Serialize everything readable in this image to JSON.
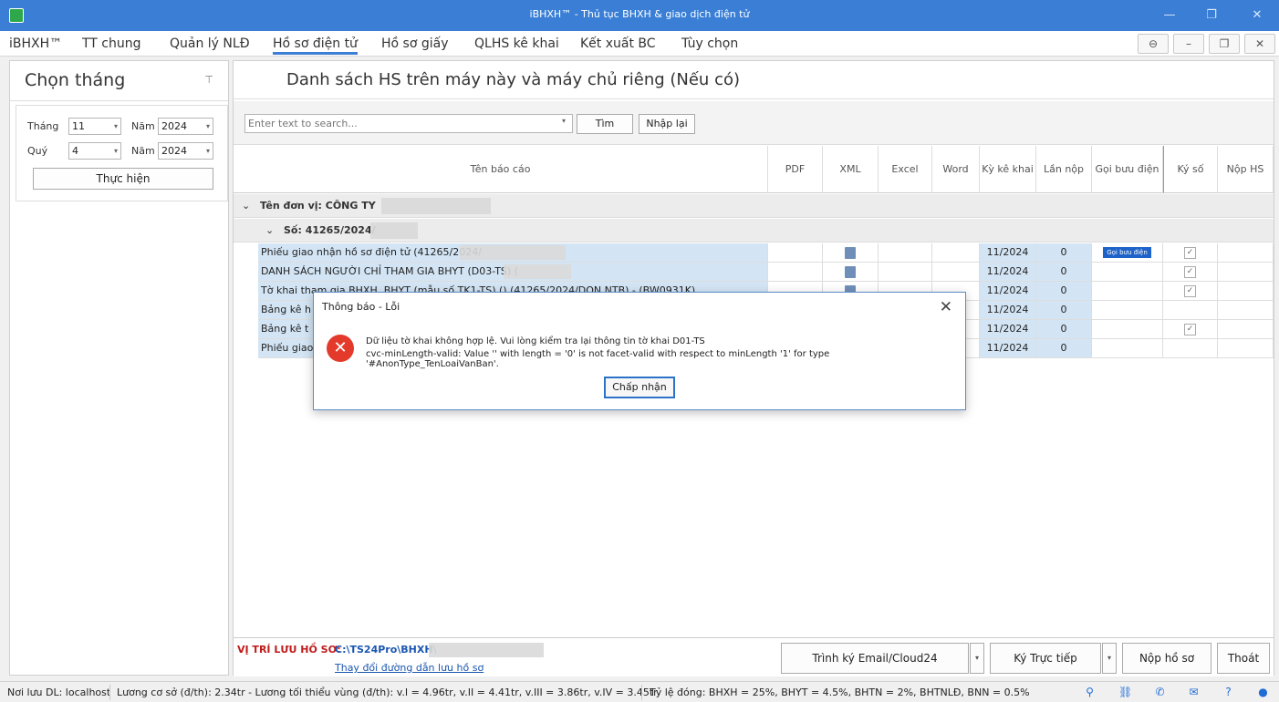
{
  "window": {
    "title": "iBHXH™ - Thủ tục BHXH & giao dịch điện tử",
    "minimize": "—",
    "restore": "❐",
    "close": "✕"
  },
  "menu": {
    "items": [
      "iBHXH™",
      "TT chung",
      "Quản lý NLĐ",
      "Hồ sơ điện tử",
      "Hồ sơ giấy",
      "QLHS kê khai",
      "Kết xuất BC",
      "Tùy chọn"
    ],
    "active_index": 3,
    "sys_buttons": [
      "⊖",
      "–",
      "❐",
      "✕"
    ]
  },
  "left": {
    "title": "Chọn tháng",
    "pin": "⊤",
    "thang_label": "Tháng",
    "thang_value": "11",
    "nam_label": "Năm",
    "nam_value": "2024",
    "quy_label": "Quý",
    "quy_value": "4",
    "nam2_label": "Năm",
    "nam2_value": "2024",
    "run_button": "Thực hiện"
  },
  "main": {
    "title": "Danh sách HS trên máy này và máy chủ riêng (Nếu có)",
    "search_placeholder": "Enter text to search...",
    "search_button": "Tìm",
    "reset_button": "Nhập lại",
    "columns": [
      "Tên báo cáo",
      "PDF",
      "XML",
      "Excel",
      "Word",
      "Kỳ kê khai",
      "Lần nộp",
      "Gọi bưu điện",
      "Ký số",
      "Nộp HS"
    ],
    "group1": "Tên đơn vị: CÔNG TY",
    "group2": "Số: 41265/2024/",
    "rows": [
      {
        "name": "Phiếu giao nhận hồ sơ điện tử (41265/2024/",
        "ky": "11/2024",
        "lan": "0",
        "buudien": "Gọi bưu điện",
        "kyso": true
      },
      {
        "name": "   DANH SÁCH NGƯỜI CHỈ THAM GIA BHYT (D03-TS) (",
        "ky": "11/2024",
        "lan": "0",
        "buudien": "",
        "kyso": true
      },
      {
        "name": "Tờ khai tham gia BHXH, BHYT (mẫu số TK1-TS) () (41265/2024/DON NTB) - (BW0931K)",
        "ky": "11/2024",
        "lan": "0",
        "buudien": "",
        "kyso": true
      },
      {
        "name": "Bảng kê h",
        "ky": "11/2024",
        "lan": "0",
        "buudien": "",
        "kyso": false
      },
      {
        "name": "Bảng kê t",
        "ky": "11/2024",
        "lan": "0",
        "buudien": "",
        "kyso": true
      },
      {
        "name": "Phiếu giao n",
        "ky": "11/2024",
        "lan": "0",
        "buudien": "",
        "kyso": false
      }
    ],
    "path_label": "VỊ TRÍ LƯU HỒ SƠ:",
    "path_value": "C:\\TS24Pro\\BHXH\\",
    "path_link": "Thay đổi đường dẫn lưu hồ sơ",
    "btn_email": "Trình ký Email/Cloud24",
    "btn_ky": "Ký Trực tiếp",
    "btn_nop": "Nộp hồ sơ",
    "btn_thoat": "Thoát",
    "drop": "▾"
  },
  "status": {
    "server": "Nơi lưu DL: localhost",
    "luong": "Lương cơ sở (đ/th): 2.34tr - Lương tối thiểu vùng (đ/th): v.I = 4.96tr, v.II = 4.41tr, v.III = 3.86tr, v.IV = 3.45tr",
    "tyle": "Tỷ lệ đóng: BHXH = 25%, BHYT = 4.5%, BHTN = 2%, BHTNLĐ, BNN = 0.5%"
  },
  "dialog": {
    "title": "Thông báo - Lỗi",
    "close": "✕",
    "icon": "✕",
    "line1": "Dữ liệu tờ khai không hợp lệ. Vui lòng kiểm tra lại thông tin tờ khai D01-TS",
    "line2": "cvc-minLength-valid: Value '' with length = '0' is not facet-valid with respect to minLength '1' for type '#AnonType_TenLoaiVanBan'.",
    "ok": "Chấp nhận"
  },
  "colors": {
    "titlebar": "#3a7fd5",
    "selected_cell": "#d3e5f5",
    "error": "#e33a2c",
    "path_label": "#c01a1a",
    "link": "#1a56b0"
  }
}
